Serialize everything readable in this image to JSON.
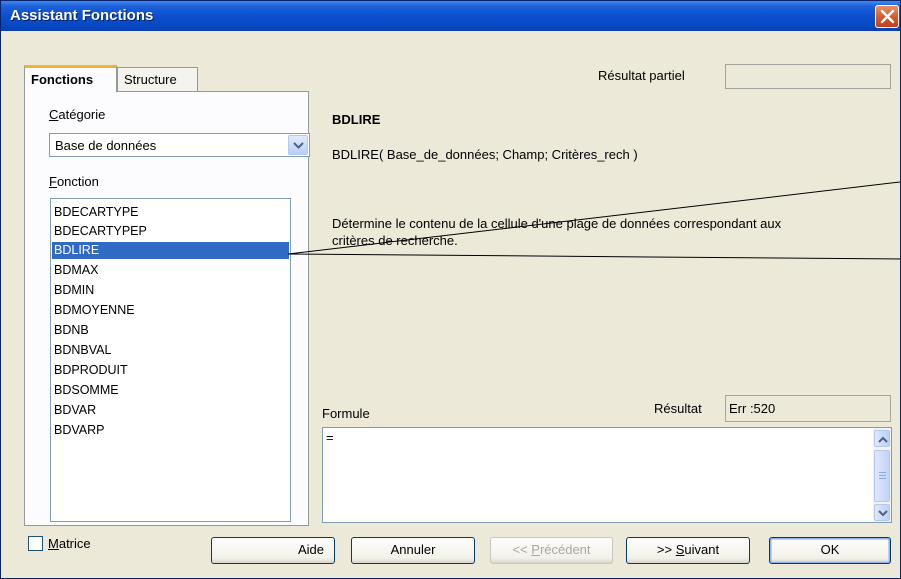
{
  "window": {
    "title": "Assistant Fonctions"
  },
  "tabs": [
    {
      "label": "Fonctions"
    },
    {
      "label": "Structure"
    }
  ],
  "category": {
    "label_underlined": "C",
    "label_rest": "atégorie",
    "selected": "Base de données"
  },
  "function": {
    "label_underlined": "F",
    "label_rest": "onction",
    "items": [
      "BDECARTYPE",
      "BDECARTYPEP",
      "BDLIRE",
      "BDMAX",
      "BDMIN",
      "BDMOYENNE",
      "BDNB",
      "BDNBVAL",
      "BDPRODUIT",
      "BDSOMME",
      "BDVAR",
      "BDVARP"
    ],
    "selected": "BDLIRE"
  },
  "partial_result": {
    "label": "Résultat partiel",
    "value": ""
  },
  "details": {
    "name": "BDLIRE",
    "signature": "BDLIRE( Base_de_données; Champ; Critères_rech )",
    "description_line1": "Détermine le contenu de la cellule d'une plage de données correspondant aux",
    "description_line2": "critères de recherche."
  },
  "result": {
    "label": "Résultat",
    "value": "Err :520"
  },
  "formula": {
    "label": "Formule",
    "value": "="
  },
  "matrix": {
    "label_underlined": "M",
    "label_rest": "atrice",
    "checked": false
  },
  "buttons": {
    "help": "Aide",
    "cancel": "Annuler",
    "prev_prefix": "<< ",
    "prev_underlined": "P",
    "prev_rest": "récédent",
    "next_prefix": ">> ",
    "next_underlined": "S",
    "next_rest": "uivant",
    "ok": "OK"
  }
}
